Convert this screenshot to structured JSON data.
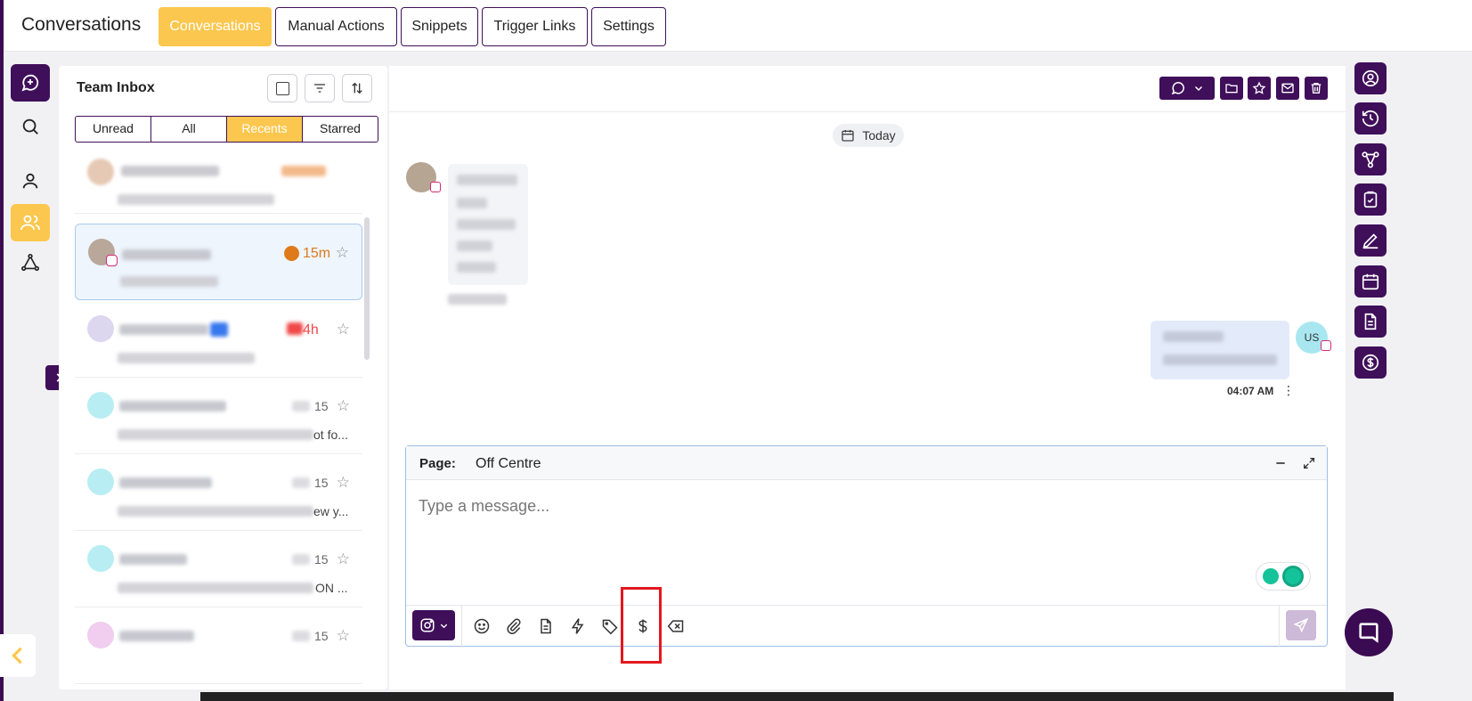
{
  "app": {
    "title": "Conversations"
  },
  "tabs": [
    {
      "label": "Conversations",
      "active": true
    },
    {
      "label": "Manual Actions"
    },
    {
      "label": "Snippets"
    },
    {
      "label": "Trigger Links"
    },
    {
      "label": "Settings"
    }
  ],
  "inbox": {
    "title": "Team Inbox",
    "filters": [
      {
        "label": "Unread"
      },
      {
        "label": "All"
      },
      {
        "label": "Recents",
        "active": true
      },
      {
        "label": "Starred"
      }
    ],
    "conversations": [
      {
        "time": "",
        "star": "☆"
      },
      {
        "time": "15m",
        "star": "☆",
        "selected": true
      },
      {
        "time": "4h",
        "star": "☆"
      },
      {
        "time": "15",
        "preview_tail": "ot fo...",
        "star": "☆"
      },
      {
        "time": "15",
        "preview_tail": "ew y...",
        "star": "☆"
      },
      {
        "time": "15",
        "preview_tail": "ON ...",
        "star": "☆"
      },
      {
        "time": "15",
        "star": "☆"
      }
    ]
  },
  "chat": {
    "date_chip": "Today",
    "outgoing_time": "04:07 AM",
    "outgoing_avatar": "US",
    "composer": {
      "page_label": "Page:",
      "page_value": "Off Centre",
      "placeholder": "Type a message..."
    }
  },
  "colors": {
    "primary": "#3f0f5a",
    "accent": "#fcc74e",
    "highlight": "#e3181d"
  }
}
